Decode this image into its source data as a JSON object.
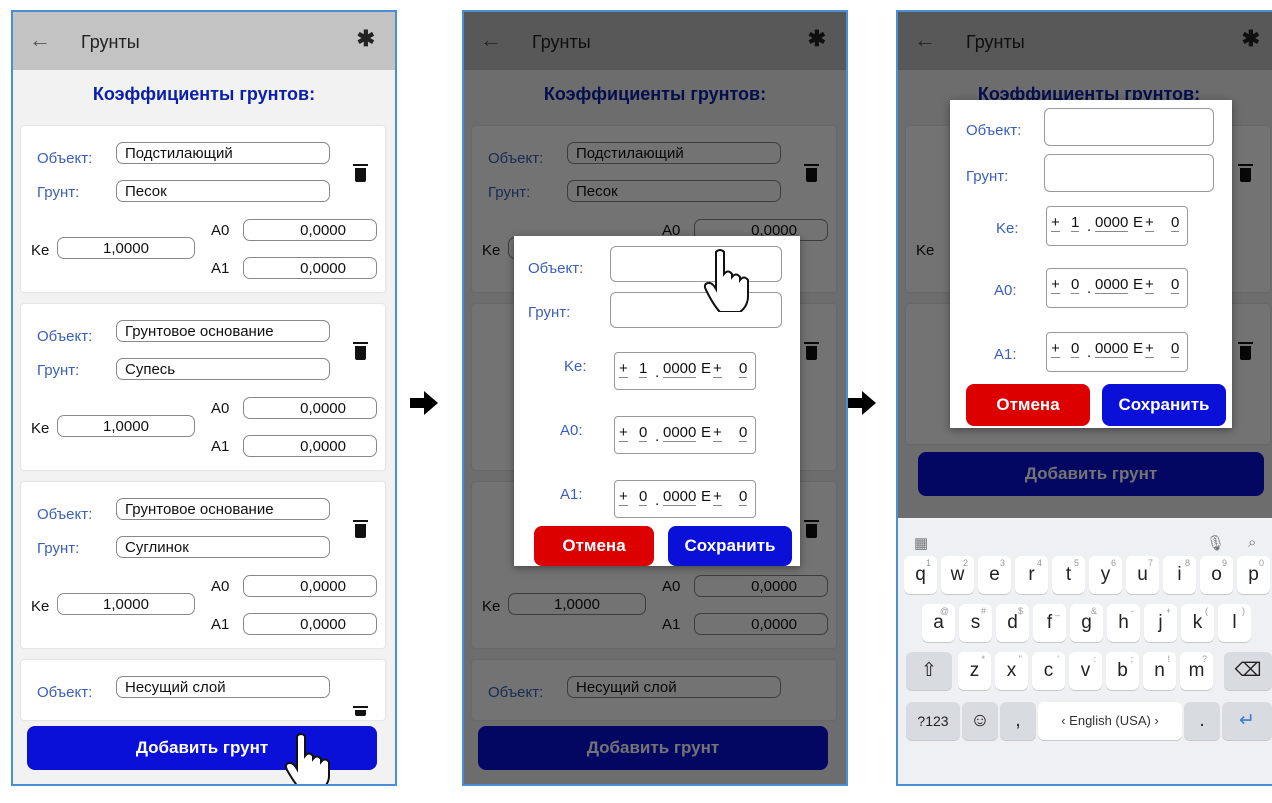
{
  "screen1": {
    "title": "Грунты",
    "heading": "Коэффициенты грунтов:",
    "object_label": "Объект:",
    "soil_label": "Грунт:",
    "ke_label": "Ke",
    "a0_label": "A0",
    "a1_label": "A1",
    "cards": [
      {
        "object": "Подстилающий",
        "soil": "Песок",
        "ke": "1,0000",
        "a0": "0,0000",
        "a1": "0,0000"
      },
      {
        "object": "Грунтовое основание",
        "soil": "Супесь",
        "ke": "1,0000",
        "a0": "0,0000",
        "a1": "0,0000"
      },
      {
        "object": "Грунтовое основание",
        "soil": "Суглинок",
        "ke": "1,0000",
        "a0": "0,0000",
        "a1": "0,0000"
      },
      {
        "object": "Несущий слой"
      }
    ],
    "add_button": "Добавить грунт"
  },
  "dialog": {
    "object_label": "Объект:",
    "soil_label": "Грунт:",
    "ke_label": "Ke:",
    "a0_label": "A0:",
    "a1_label": "A1:",
    "ke": {
      "sign": "+",
      "int": "1",
      "frac": "0000",
      "e": "E",
      "esign": "+",
      "exp": "0"
    },
    "a0": {
      "sign": "+",
      "int": "0",
      "frac": "0000",
      "e": "E",
      "esign": "+",
      "exp": "0"
    },
    "a1": {
      "sign": "+",
      "int": "0",
      "frac": "0000",
      "e": "E",
      "esign": "+",
      "exp": "0"
    },
    "dot": ".",
    "cancel": "Отмена",
    "save": "Сохранить"
  },
  "keyboard": {
    "row1": [
      "q",
      "w",
      "e",
      "r",
      "t",
      "y",
      "u",
      "i",
      "o",
      "p"
    ],
    "row1_hints": [
      "1",
      "2",
      "3",
      "4",
      "5",
      "6",
      "7",
      "8",
      "9",
      "0"
    ],
    "row2": [
      "a",
      "s",
      "d",
      "f",
      "g",
      "h",
      "j",
      "k",
      "l"
    ],
    "row2_hints": [
      "@",
      "#",
      "$",
      "_",
      "&",
      "-",
      "+",
      "(",
      ")"
    ],
    "row3": [
      "z",
      "x",
      "c",
      "v",
      "b",
      "n",
      "m"
    ],
    "row3_hints": [
      "*",
      "\"",
      "'",
      ":",
      ";",
      "!",
      "?"
    ],
    "sym_key": "?123",
    "comma": ",",
    "space": "‹ English (USA) ›",
    "period": ".",
    "period_hint": "!?"
  },
  "colors": {
    "accent": "#0a10d8",
    "cancel": "#dd0000",
    "label": "#3b5fb8",
    "heading": "#0b20a8"
  }
}
